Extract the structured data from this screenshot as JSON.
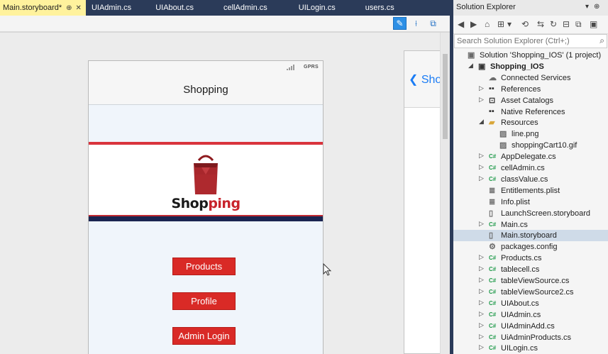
{
  "tabs": [
    {
      "label": "Main.storyboard*",
      "active": true
    },
    {
      "label": "UIAdmin.cs",
      "active": false
    },
    {
      "label": "UIAbout.cs",
      "active": false
    },
    {
      "label": "cellAdmin.cs",
      "active": false
    },
    {
      "label": "UILogin.cs",
      "active": false
    },
    {
      "label": "users.cs",
      "active": false
    }
  ],
  "active_tab_controls": {
    "pin": "⊕",
    "close": "✕"
  },
  "designer": {
    "phone": {
      "carrier": "GPRS",
      "nav_title": "Shopping",
      "logo_text_dark": "Shop",
      "logo_text_red": "ping",
      "buttons": [
        {
          "label": "Products"
        },
        {
          "label": "Profile"
        },
        {
          "label": "Admin Login"
        }
      ]
    },
    "peek_back_label": "Sho",
    "peek_back_icon": "chevron-left-icon"
  },
  "solution_explorer": {
    "title": "Solution Explorer",
    "search_placeholder": "Search Solution Explorer (Ctrl+;)",
    "tree": [
      {
        "label": "Solution 'Shopping_IOS' (1 project)",
        "icon": "solution-icon",
        "level": 0,
        "arrow": ""
      },
      {
        "label": "Shopping_IOS",
        "icon": "project-icon",
        "level": 1,
        "arrow": "expanded",
        "bold": true
      },
      {
        "label": "Connected Services",
        "icon": "cloud-icon",
        "level": 2,
        "arrow": ""
      },
      {
        "label": "References",
        "icon": "references-icon",
        "level": 2,
        "arrow": "collapsed"
      },
      {
        "label": "Asset Catalogs",
        "icon": "asset-catalog-icon",
        "level": 2,
        "arrow": "collapsed"
      },
      {
        "label": "Native References",
        "icon": "references-icon",
        "level": 2,
        "arrow": ""
      },
      {
        "label": "Resources",
        "icon": "folder-icon",
        "level": 2,
        "arrow": "expanded"
      },
      {
        "label": "line.png",
        "icon": "image-file-icon",
        "level": 3,
        "arrow": ""
      },
      {
        "label": "shoppingCart10.gif",
        "icon": "image-file-icon",
        "level": 3,
        "arrow": ""
      },
      {
        "label": "AppDelegate.cs",
        "icon": "csharp-icon",
        "level": 2,
        "arrow": "collapsed"
      },
      {
        "label": "cellAdmin.cs",
        "icon": "csharp-icon",
        "level": 2,
        "arrow": "collapsed"
      },
      {
        "label": "classValue.cs",
        "icon": "csharp-icon",
        "level": 2,
        "arrow": "collapsed"
      },
      {
        "label": "Entitlements.plist",
        "icon": "plist-file-icon",
        "level": 2,
        "arrow": ""
      },
      {
        "label": "Info.plist",
        "icon": "plist-file-icon",
        "level": 2,
        "arrow": ""
      },
      {
        "label": "LaunchScreen.storyboard",
        "icon": "file-icon",
        "level": 2,
        "arrow": ""
      },
      {
        "label": "Main.cs",
        "icon": "csharp-icon",
        "level": 2,
        "arrow": "collapsed"
      },
      {
        "label": "Main.storyboard",
        "icon": "file-icon",
        "level": 2,
        "arrow": "",
        "selected": true
      },
      {
        "label": "packages.config",
        "icon": "config-file-icon",
        "level": 2,
        "arrow": ""
      },
      {
        "label": "Products.cs",
        "icon": "csharp-icon",
        "level": 2,
        "arrow": "collapsed"
      },
      {
        "label": "tablecell.cs",
        "icon": "csharp-icon",
        "level": 2,
        "arrow": "collapsed"
      },
      {
        "label": "tableViewSource.cs",
        "icon": "csharp-icon",
        "level": 2,
        "arrow": "collapsed"
      },
      {
        "label": "tableViewSource2.cs",
        "icon": "csharp-icon",
        "level": 2,
        "arrow": "collapsed"
      },
      {
        "label": "UIAbout.cs",
        "icon": "csharp-icon",
        "level": 2,
        "arrow": "collapsed"
      },
      {
        "label": "UIAdmin.cs",
        "icon": "csharp-icon",
        "level": 2,
        "arrow": "collapsed"
      },
      {
        "label": "UIAdminAdd.cs",
        "icon": "csharp-icon",
        "level": 2,
        "arrow": "collapsed"
      },
      {
        "label": "UiAdminProducts.cs",
        "icon": "csharp-icon",
        "level": 2,
        "arrow": "collapsed"
      },
      {
        "label": "UILogin.cs",
        "icon": "csharp-icon",
        "level": 2,
        "arrow": "collapsed"
      }
    ]
  },
  "colors": {
    "ide_chrome": "#2b3b59",
    "active_tab": "#fff29d",
    "phone_button": "#d92a26",
    "logo_red": "#c8242c",
    "logo_navy": "#1a2450",
    "back_link": "#1a7cf5",
    "csharp_badge": "#1f9a4a",
    "selection": "#cfdbe8"
  }
}
